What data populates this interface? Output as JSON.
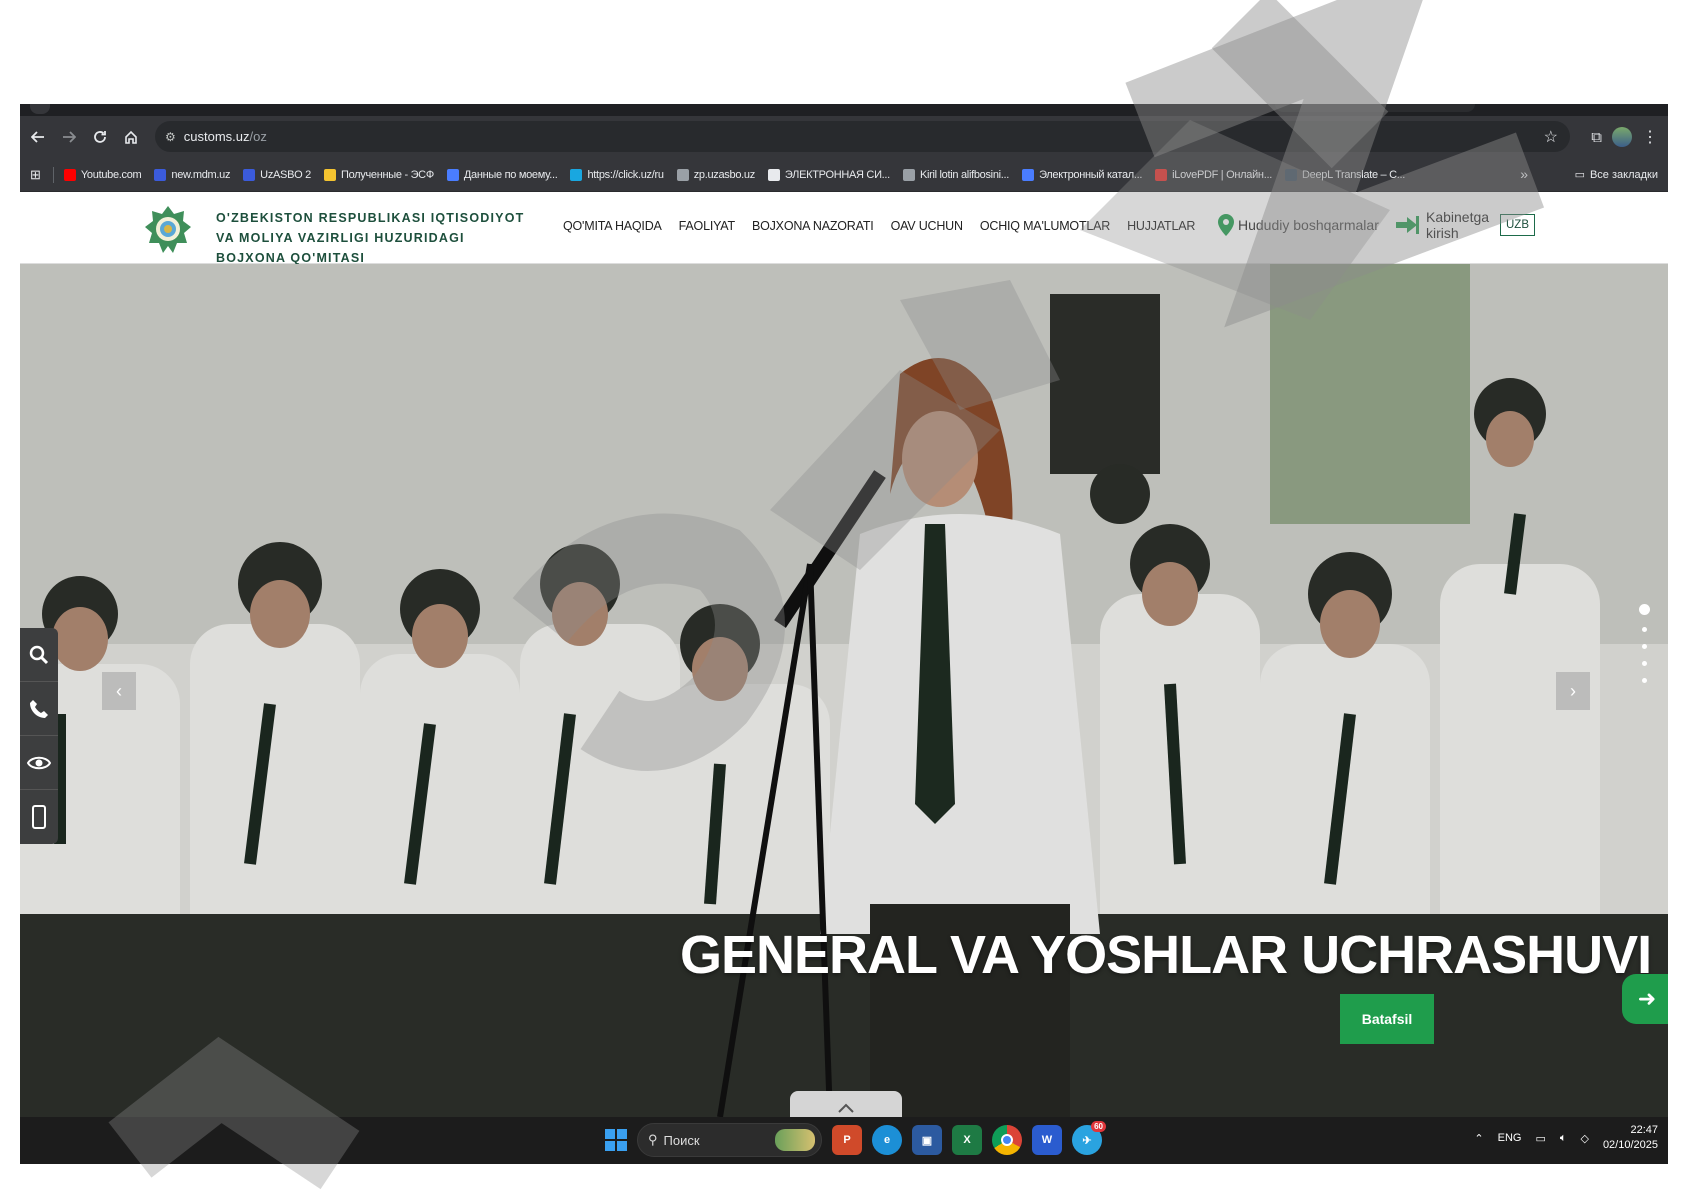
{
  "browser": {
    "url_host": "customs.uz",
    "url_path": "/oz",
    "bookmarks": [
      {
        "label": "Youtube.com",
        "color": "#ff0000"
      },
      {
        "label": "new.mdm.uz",
        "color": "#3b5bdb"
      },
      {
        "label": "UzASBO 2",
        "color": "#3b5bdb"
      },
      {
        "label": "Полученные - ЭСФ",
        "color": "#f4c430"
      },
      {
        "label": "Данные по моему...",
        "color": "#4a7dff"
      },
      {
        "label": "https://click.uz/ru",
        "color": "#19a7e0"
      },
      {
        "label": "zp.uzasbo.uz",
        "color": "#9aa0a6"
      },
      {
        "label": "ЭЛЕКТРОННАЯ СИ...",
        "color": "#e8eaed"
      },
      {
        "label": "Kiril lotin alifbosini...",
        "color": "#9aa0a6"
      },
      {
        "label": "Электронный катал...",
        "color": "#4a7dff"
      },
      {
        "label": "iLovePDF | Онлайн...",
        "color": "#e5322d"
      },
      {
        "label": "DeepL Translate – С...",
        "color": "#0f2b46"
      }
    ],
    "all_bookmarks": "Все закладки",
    "more": "»"
  },
  "site": {
    "org_name": "O'ZBEKISTON RESPUBLIKASI IQTISODIYOT VA MOLIYA VAZIRLIGI HUZURIDAGI BOJXONA QO'MITASI",
    "nav": [
      "QO'MITA HAQIDA",
      "FAOLIYAT",
      "BOJXONA NAZORATI",
      "OAV UCHUN",
      "OCHIQ MA'LUMOTLAR",
      "HUJJATLAR"
    ],
    "region_link": "Hududiy boshqarmalar",
    "cabinet_link": "Kabinetga kirish",
    "language": "UZB",
    "accent": "#1f9d4c"
  },
  "hero": {
    "title": "GENERAL VA YOSHLAR UCHRASHUVI",
    "button": "Batafsil",
    "slide_count": 5,
    "active_slide": 1,
    "prev": "‹",
    "next": "›"
  },
  "taskbar": {
    "search_placeholder": "Поиск",
    "language": "ENG",
    "time": "22:47",
    "date": "02/10/2025",
    "telegram_badge": "60"
  }
}
